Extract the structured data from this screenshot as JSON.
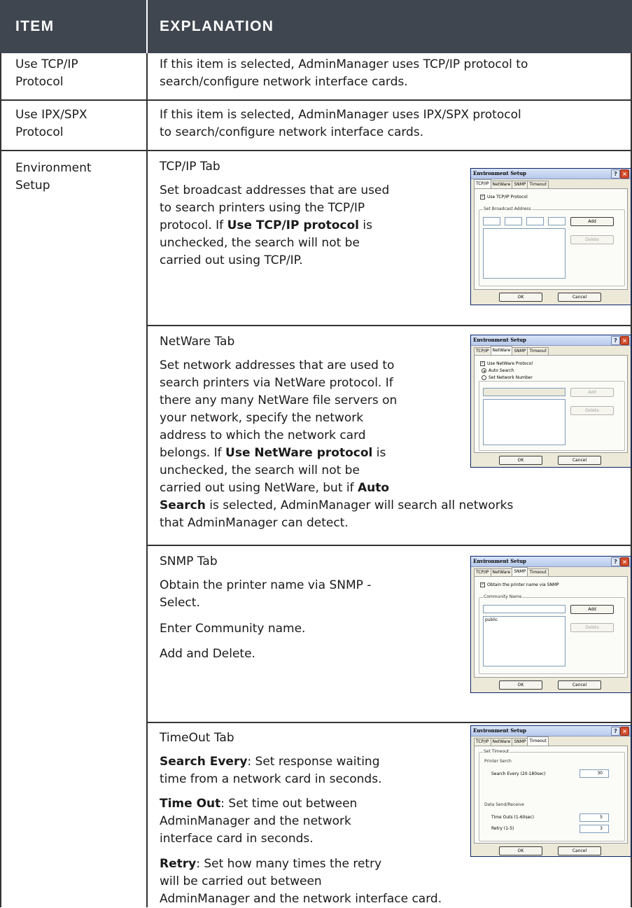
{
  "header": {
    "item": "ITEM",
    "explanation": "EXPLANATION"
  },
  "rows": {
    "tcpip": {
      "item_line1": "Use TCP/IP",
      "item_line2": "Protocol",
      "explanation_line1": "If this item is selected, AdminManager uses TCP/IP protocol to",
      "explanation_line2": "search/configure network interface cards."
    },
    "ipx": {
      "item_line1": "Use IPX/SPX",
      "item_line2": "Protocol",
      "explanation_line1": "If this item is selected, AdminManager uses IPX/SPX protocol",
      "explanation_line2": "to search/configure network interface cards."
    },
    "env": {
      "item_line1": "Environment",
      "item_line2": "Setup"
    }
  },
  "tcpip_tab": {
    "heading": "TCP/IP Tab",
    "l1": "Set broadcast addresses that are used",
    "l2": "to search printers using the TCP/IP",
    "l3_a": "protocol. If ",
    "l3_b": "Use TCP/IP protocol",
    "l3_c": " is",
    "l4": "unchecked, the search will not be",
    "l5": "carried out using TCP/IP."
  },
  "netware_tab": {
    "heading": "NetWare Tab",
    "l1": "Set network addresses that are used to",
    "l2": "search printers via NetWare protocol. If",
    "l3": "there any many NetWare file servers on",
    "l4": "your network, specify the network",
    "l5": "address to which the network card",
    "l6_a": "belongs. If ",
    "l6_b": "Use NetWare protocol",
    "l6_c": " is",
    "l7": "unchecked, the search will not be",
    "l8_a": "carried out using NetWare, but if ",
    "l8_b": "Auto",
    "l9_a": "Search",
    "l9_b": " is selected, AdminManager will search all networks",
    "l10": "that AdminManager can detect."
  },
  "snmp_tab": {
    "heading": "SNMP Tab",
    "l1": "Obtain the printer name via SNMP -",
    "l2": "Select.",
    "l3": "Enter Community name.",
    "l4": "Add and Delete."
  },
  "timeout_tab": {
    "heading": "TimeOut Tab",
    "p1_b": "Search Every",
    "p1_a": ": Set response waiting",
    "p1_l2": "time from a network card in seconds.",
    "p2_b": "Time Out",
    "p2_a": ": Set time out between",
    "p2_l2": "AdminManager and the network",
    "p2_l3": "interface card in seconds.",
    "p3_b": "Retry",
    "p3_a": ": Set how many times the retry",
    "p3_l2": "will be carried out between",
    "p3_l3": "AdminManager and the network interface card."
  },
  "dialog": {
    "title": "Environment Setup",
    "help": "?",
    "close": "×",
    "tabs": [
      "TCP/IP",
      "NetWare",
      "SNMP",
      "Timeout"
    ],
    "ok": "OK",
    "cancel": "Cancel",
    "add": "Add",
    "delete": "Delete",
    "tcp": {
      "checkbox": "Use TCP/IP Protocol",
      "group": "Set Broadcast Address"
    },
    "netware": {
      "checkbox": "Use NetWare Protocol",
      "radio_auto": "Auto Search",
      "radio_set": "Set Network Number"
    },
    "snmp": {
      "checkbox": "Obtain the printer name via SNMP",
      "group": "Community Name",
      "list_item": "public"
    },
    "timeout": {
      "group": "Set Timeout",
      "printer_serch": "Printer Serch",
      "search_every": "Search Every (20-180sec)",
      "search_every_value": "30",
      "data_send": "Data Send/Receive",
      "time_outs": "Time Outs (1-60sec)",
      "time_outs_value": "5",
      "retry": "Retry (1-5)",
      "retry_value": "3"
    }
  }
}
